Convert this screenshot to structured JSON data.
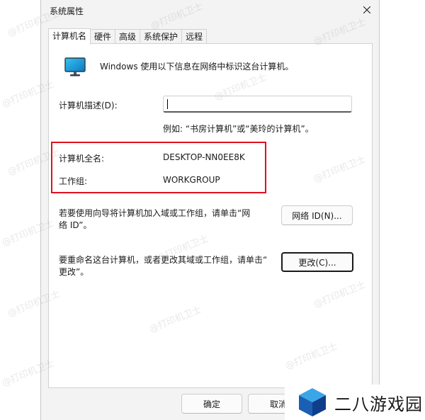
{
  "window": {
    "title": "系统属性"
  },
  "tabs": [
    {
      "label": "计算机名",
      "active": true
    },
    {
      "label": "硬件",
      "active": false
    },
    {
      "label": "高级",
      "active": false
    },
    {
      "label": "系统保护",
      "active": false
    },
    {
      "label": "远程",
      "active": false
    }
  ],
  "info_text": "Windows 使用以下信息在网络中标识这台计算机。",
  "description": {
    "label": "计算机描述(D):",
    "value": "",
    "example": "例如: “书房计算机”或“美玲的计算机”。"
  },
  "full_name": {
    "label": "计算机全名:",
    "value": "DESKTOP-NN0EE8K"
  },
  "workgroup": {
    "label": "工作组:",
    "value": "WORKGROUP"
  },
  "network_id": {
    "text_line1": "若要使用向导将计算机加入域或工作组，请单击“网",
    "text_line2": "络 ID”。",
    "button": "网络 ID(N)..."
  },
  "rename": {
    "text_line1": "要重命名这台计算机，或者更改其域或工作组，请单击“",
    "text_line2": "更改”。",
    "button": "更改(C)..."
  },
  "footer": {
    "ok": "确定",
    "cancel": "取消"
  },
  "watermark": "@打印机卫士",
  "logo": {
    "text": "二八游戏园"
  },
  "colors": {
    "highlight": "#e01020",
    "window_bg": "#f3f3f3",
    "panel_bg": "#ffffff"
  }
}
